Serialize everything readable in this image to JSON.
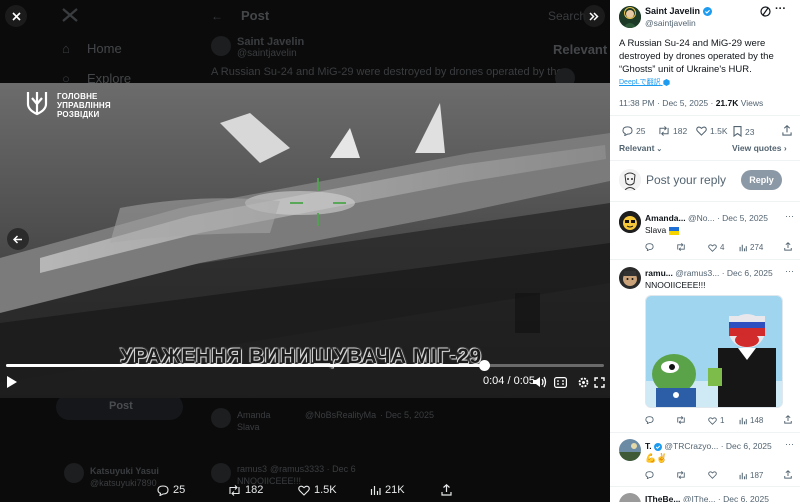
{
  "viewer": {
    "bg_nav": {
      "post_header": "Post",
      "home": "Home",
      "explore": "Explore",
      "search_placeholder": "Search",
      "relevant_people": "Relevant p",
      "bg_author": "Saint Javelin",
      "bg_handle": "@saintjavelin",
      "bg_text": "A Russian Su-24 and MiG-29 were destroyed by drones operated by the",
      "post_button": "Post",
      "bg_user_name": "Katsuyuki Yasui",
      "bg_user_handle": "@katsuyuki7890",
      "bg_reply_name": "Amanda",
      "bg_reply_handle": "@NoBsRealityMa",
      "bg_reply_date": "· Dec 5, 2025",
      "bg_reply_text": "Slava",
      "bg_reply2_name": "ramus3",
      "bg_reply2_handle": "@ramus3333 · Dec 6",
      "bg_reply2_text": "NNOOIICEEE!!!"
    },
    "video": {
      "logo_lines": [
        "ГОЛОВНЕ",
        "УПРАВЛІННЯ",
        "РОЗВІДКИ"
      ],
      "subtitle": "УРАЖЕННЯ ВИНИЩУВАЧА МІГ-29",
      "time_label": "0:04 / 0:05",
      "progress": 0.8
    },
    "stats": {
      "replies": "25",
      "reposts": "182",
      "likes": "1.5K",
      "views": "21K"
    }
  },
  "panel": {
    "author_name": "Saint Javelin",
    "author_handle": "@saintjavelin",
    "tweet_text": "A Russian Su-24 and MiG-29 were destroyed by drones operated by the “Ghosts” unit of Ukraine's HUR.",
    "translate_label": "DeepLで翻訳",
    "timestamp": "11:38 PM · Dec 5, 2025 · ",
    "views_count": "21.7K",
    "views_label": " Views",
    "actions": {
      "replies": "25",
      "reposts": "182",
      "likes": "1.5K",
      "bookmarks": "23"
    },
    "relevant_label": "Relevant",
    "view_quotes_label": "View quotes",
    "reply_placeholder": "Post your reply",
    "reply_button": "Reply",
    "replies": [
      {
        "name": "Amanda...",
        "handle": "@No...",
        "date": "· Dec 5, 2025",
        "text": "Slava",
        "replies": "",
        "reposts": "",
        "likes": "4",
        "views": "274"
      },
      {
        "name": "ramu...",
        "handle": "@ramus3...",
        "date": "· Dec 6, 2025",
        "text": "NNOOIICEEE!!!",
        "replies": "",
        "reposts": "",
        "likes": "1",
        "views": "148"
      },
      {
        "name": "T.",
        "handle": "@TRCrazyo...",
        "date": "· Dec 6, 2025",
        "text": "",
        "replies": "",
        "reposts": "",
        "likes": "",
        "views": "187"
      },
      {
        "name": "ITheBe...",
        "handle": "@IThe...",
        "date": "· Dec 6, 2025"
      }
    ]
  },
  "colors": {
    "accent": "#1d9bf0",
    "verified": "#1d9bf0",
    "dark_bg": "#000000",
    "text": "#0f1419",
    "muted": "#536471"
  }
}
